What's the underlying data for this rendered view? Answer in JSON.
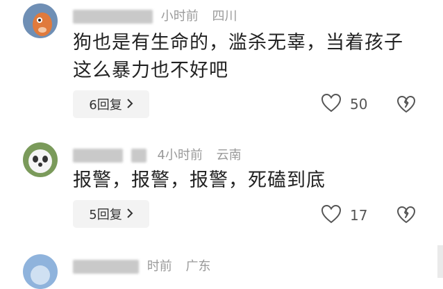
{
  "comments": [
    {
      "time": "小时前",
      "location": "四川",
      "text_line1": "狗也是有生命的，滥杀无辜，当着孩子",
      "text_line2": "这么暴力也不好吧",
      "reply_label": "6回复",
      "likes": "50"
    },
    {
      "time": "4小时前",
      "location": "云南",
      "text_line1": "报警，报警，报警，死磕到底",
      "reply_label": "5回复",
      "likes": "17"
    },
    {
      "time": "时前",
      "location": "广东"
    }
  ],
  "icons": {
    "like": "heart-icon",
    "dislike": "broken-heart-icon",
    "reply_arrow": "chevron-right-icon"
  },
  "colors": {
    "meta": "#9a9a9a",
    "text": "#222222",
    "reply_bg": "#f3f3f3"
  }
}
